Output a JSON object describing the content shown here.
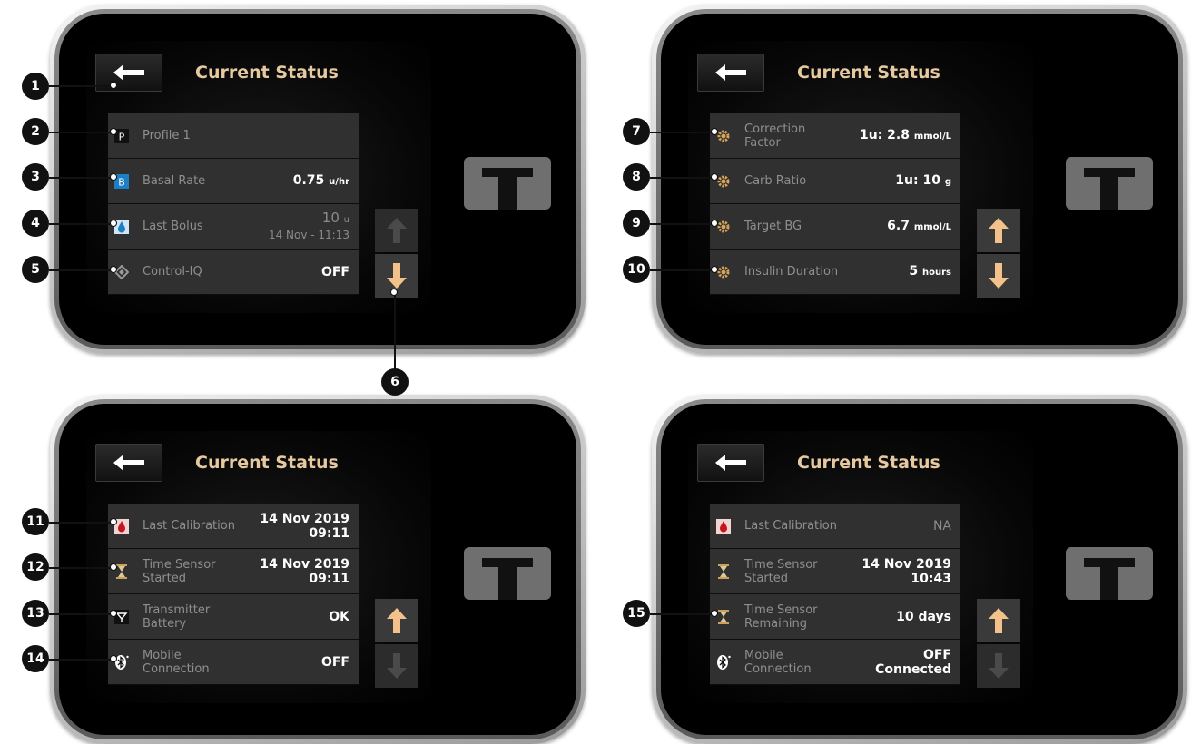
{
  "screen_title": "Current Status",
  "panels": [
    {
      "rows": [
        {
          "icon": "profile-icon",
          "label": "Profile 1",
          "value": ""
        },
        {
          "icon": "basal-icon",
          "label": "Basal Rate",
          "value": "0.75",
          "unit": "u/hr"
        },
        {
          "icon": "bolus-drop-icon",
          "label": "Last Bolus",
          "value": "10",
          "unit": "u",
          "value2": "14 Nov - 11:13"
        },
        {
          "icon": "control-iq-icon",
          "label": "Control-IQ",
          "value": "OFF"
        }
      ],
      "up_enabled": false,
      "down_enabled": true
    },
    {
      "rows": [
        {
          "icon": "gear-icon",
          "label": "Correction",
          "label2": "Factor",
          "value": "1u: 2.8",
          "unit": "mmol/L"
        },
        {
          "icon": "gear-icon",
          "label": "Carb Ratio",
          "value": "1u: 10",
          "unit": "g"
        },
        {
          "icon": "gear-icon",
          "label": "Target BG",
          "value": "6.7",
          "unit": "mmol/L"
        },
        {
          "icon": "gear-icon",
          "label": "Insulin Duration",
          "value": "5",
          "unit": "hours"
        }
      ],
      "up_enabled": true,
      "down_enabled": true
    },
    {
      "rows": [
        {
          "icon": "blood-drop-icon",
          "label": "Last Calibration",
          "value": "14 Nov 2019",
          "value2": "09:11"
        },
        {
          "icon": "hourglass-icon",
          "label": "Time Sensor",
          "label2": "Started",
          "value": "14 Nov 2019",
          "value2": "09:11"
        },
        {
          "icon": "transmitter-icon",
          "label": "Transmitter",
          "label2": "Battery",
          "value": "OK"
        },
        {
          "icon": "bluetooth-icon",
          "label": "Mobile",
          "label2": "Connection",
          "value": "OFF"
        }
      ],
      "up_enabled": true,
      "down_enabled": false
    },
    {
      "rows": [
        {
          "icon": "blood-drop-icon",
          "label": "Last Calibration",
          "value": "NA",
          "dim": true
        },
        {
          "icon": "hourglass-icon",
          "label": "Time Sensor",
          "label2": "Started",
          "value": "14 Nov 2019",
          "value2": "10:43"
        },
        {
          "icon": "hourglass-icon",
          "label": "Time Sensor",
          "label2": "Remaining",
          "value": "10 days"
        },
        {
          "icon": "bluetooth-icon",
          "label": "Mobile",
          "label2": "Connection",
          "value": "OFF",
          "value2": "Connected"
        }
      ],
      "up_enabled": true,
      "down_enabled": false
    }
  ],
  "callouts": [
    "1",
    "2",
    "3",
    "4",
    "5",
    "6",
    "7",
    "8",
    "9",
    "10",
    "11",
    "12",
    "13",
    "14",
    "15"
  ],
  "colors": {
    "title": "#e7c9a0",
    "row_bg": "#2f302f",
    "arrow_active": "#f2c28a",
    "arrow_disabled": "#4a4a4a"
  }
}
